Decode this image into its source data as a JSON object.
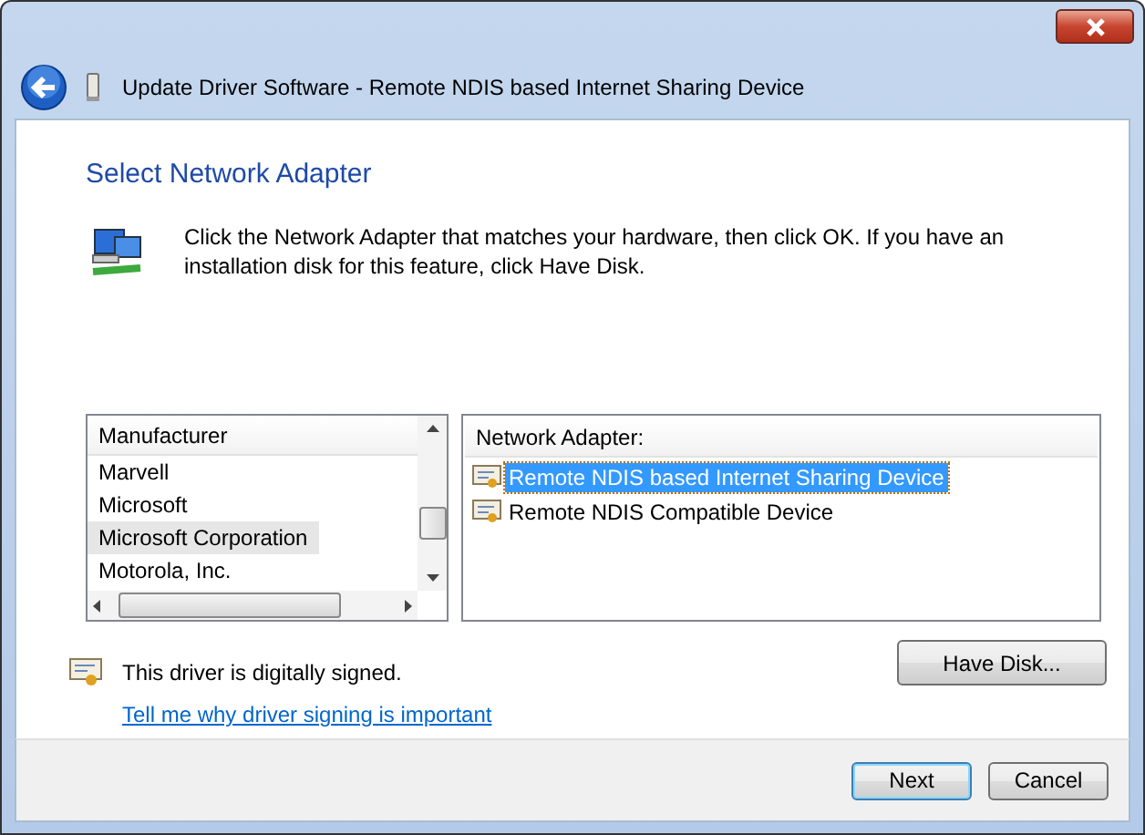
{
  "window": {
    "title": "Update Driver Software - Remote NDIS based Internet Sharing Device"
  },
  "heading": "Select Network Adapter",
  "description": "Click the Network Adapter that matches your hardware, then click OK. If you have an installation disk for this feature, click Have Disk.",
  "manufacturers": {
    "header": "Manufacturer",
    "items": [
      {
        "label": "Marvell",
        "selected": false
      },
      {
        "label": "Microsoft",
        "selected": false
      },
      {
        "label": "Microsoft Corporation",
        "selected": true
      },
      {
        "label": "Motorola, Inc.",
        "selected": false
      }
    ]
  },
  "adapters": {
    "header": "Network Adapter:",
    "items": [
      {
        "label": "Remote NDIS based Internet Sharing Device",
        "selected": true
      },
      {
        "label": "Remote NDIS Compatible Device",
        "selected": false
      }
    ]
  },
  "signature": {
    "text": "This driver is digitally signed.",
    "link": "Tell me why driver signing is important"
  },
  "have_disk_button": "Have Disk...",
  "buttons": [
    {
      "label": "Next",
      "default": true
    },
    {
      "label": "Cancel",
      "default": false
    }
  ]
}
